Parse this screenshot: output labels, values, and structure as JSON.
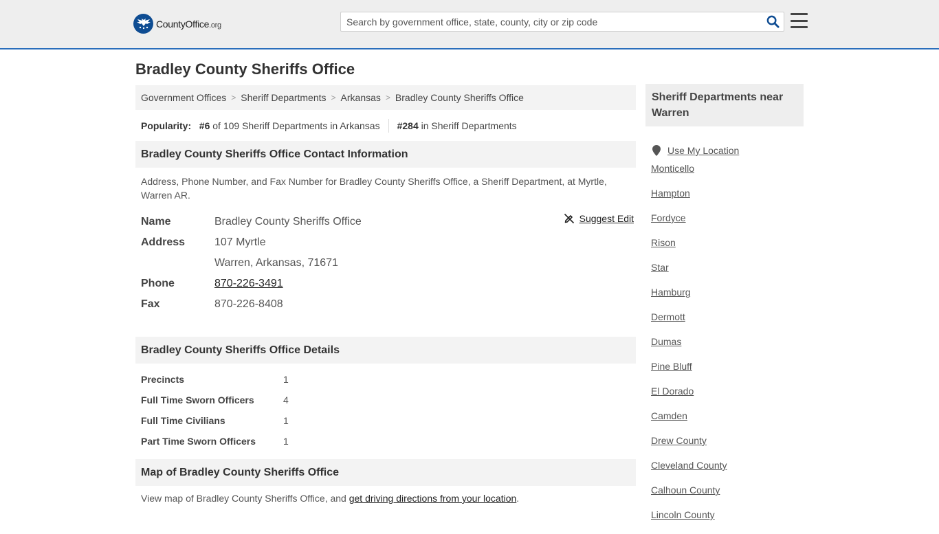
{
  "header": {
    "logo_name": "CountyOffice",
    "logo_tld": ".org",
    "search_placeholder": "Search by government office, state, county, city or zip code"
  },
  "page_title": "Bradley County Sheriffs Office",
  "breadcrumb": [
    "Government Offices",
    "Sheriff Departments",
    "Arkansas",
    "Bradley County Sheriffs Office"
  ],
  "popularity": {
    "label": "Popularity:",
    "rank_state": "#6",
    "rank_state_text": "of 109 Sheriff Departments in Arkansas",
    "rank_national": "#284",
    "rank_national_text": "in Sheriff Departments"
  },
  "contact": {
    "heading": "Bradley County Sheriffs Office Contact Information",
    "description": "Address, Phone Number, and Fax Number for Bradley County Sheriffs Office, a Sheriff Department, at Myrtle, Warren AR.",
    "suggest_edit": "Suggest Edit",
    "name_label": "Name",
    "name": "Bradley County Sheriffs Office",
    "address_label": "Address",
    "address_line1": "107 Myrtle",
    "address_line2": "Warren, Arkansas, 71671",
    "phone_label": "Phone",
    "phone": "870-226-3491",
    "fax_label": "Fax",
    "fax": "870-226-8408"
  },
  "details": {
    "heading": "Bradley County Sheriffs Office Details",
    "rows": [
      {
        "label": "Precincts",
        "value": "1"
      },
      {
        "label": "Full Time Sworn Officers",
        "value": "4"
      },
      {
        "label": "Full Time Civilians",
        "value": "1"
      },
      {
        "label": "Part Time Sworn Officers",
        "value": "1"
      }
    ]
  },
  "map": {
    "heading": "Map of Bradley County Sheriffs Office",
    "text_before": "View map of Bradley County Sheriffs Office, and ",
    "link": "get driving directions from your location",
    "text_after": "."
  },
  "sidebar": {
    "heading": "Sheriff Departments near Warren",
    "use_location": "Use My Location",
    "items": [
      "Monticello",
      "Hampton",
      "Fordyce",
      "Rison",
      "Star",
      "Hamburg",
      "Dermott",
      "Dumas",
      "Pine Bluff",
      "El Dorado",
      "Camden",
      "Drew County",
      "Cleveland County",
      "Calhoun County",
      "Lincoln County"
    ]
  },
  "colors": {
    "brand_blue": "#0e4c92",
    "header_border": "#2a6ebb",
    "section_bg": "#f3f3f3"
  }
}
